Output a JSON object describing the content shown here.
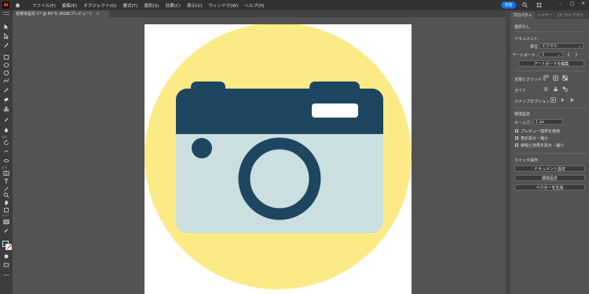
{
  "app": {
    "logo": "Ai",
    "menus": [
      "ファイル(F)",
      "編集(E)",
      "オブジェクト(O)",
      "書式(T)",
      "選択(S)",
      "効果(C)",
      "表示(V)",
      "ウィンドウ(W)",
      "ヘルプ(H)"
    ],
    "share_label": "共有",
    "window_controls": [
      "–",
      "□",
      "✕"
    ]
  },
  "document": {
    "tab_title": "名称未設定-1* @ 60 % (RGB/プレビュー)",
    "close_glyph": "✕"
  },
  "panel": {
    "tabs": [
      "プロパティ",
      "レイヤー",
      "CC ライブラリ"
    ],
    "selection": "選択なし",
    "document_heading": "ドキュメント",
    "unit_label": "単位 :",
    "unit_value": "ピクセル",
    "artboard_label": "アートボード :",
    "artboard_value": "1",
    "edit_artboard_button": "アートボードを編集",
    "rulers_grid_label": "定規とグリッド",
    "guides_label": "ガイド",
    "snap_label": "スナップオプション",
    "prefs_heading": "環境設定",
    "key_input_label": "キー入力 :",
    "key_input_value": "1 px",
    "checkboxes": [
      "プレビュー境界を使用",
      "角を拡大・縮小",
      "線幅と効果を拡大・縮小"
    ],
    "quick_actions_heading": "クイック操作",
    "buttons": [
      "ドキュメント設定",
      "環境設定",
      "ベクターを生成"
    ]
  },
  "artwork": {
    "colors": {
      "circle": "#fbea86",
      "camera_top": "#1e4660",
      "camera_body": "#cbdfe0",
      "lens": "#1e4660",
      "window": "#ffffff"
    }
  }
}
